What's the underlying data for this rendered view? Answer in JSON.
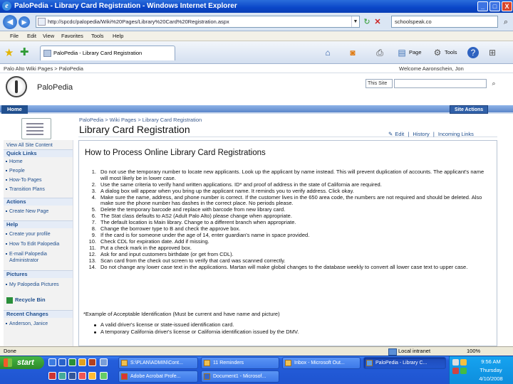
{
  "window": {
    "title": "PaloPedia - Library Card Registration - Windows Internet Explorer",
    "buttons": {
      "minimize": "_",
      "maximize": "□",
      "close": "X"
    }
  },
  "addressbar": {
    "url": "http://spcdc/palopedia/Wiki%20Pages/Library%20Card%20Registration.aspx",
    "search_value": "schoolspeak.co"
  },
  "menubar": {
    "items": [
      "File",
      "Edit",
      "View",
      "Favorites",
      "Tools",
      "Help"
    ]
  },
  "tabs": [
    {
      "label": "PaloPedia - Library Card Registration"
    }
  ],
  "commandbar": {
    "page_label": "Page",
    "tools_label": "Tools"
  },
  "sharepoint": {
    "site_crumb": "Palo Alto Wiki Pages > PaloPedia",
    "welcome": "Welcome Aaronschein, Jon",
    "site_title": "PaloPedia",
    "search_scope": "This Site",
    "home_tab": "Home",
    "site_actions": "Site Actions"
  },
  "page": {
    "breadcrumb": "PaloPedia > Wiki Pages > Library Card Registration",
    "title": "Library Card Registration",
    "toolbar": [
      "Edit",
      "History",
      "Incoming Links"
    ]
  },
  "leftnav": {
    "view_all": "View All Site Content",
    "sections": [
      {
        "header": "Quick Links",
        "items": [
          "Home",
          "People",
          "How-To Pages",
          "Transition Plans"
        ]
      },
      {
        "header": "Actions",
        "items": [
          "Create New Page"
        ]
      },
      {
        "header": "Help",
        "items": [
          "Create your profile",
          "How To Edit Palopedia",
          "E-mail Palopedia Administrator"
        ]
      },
      {
        "header": "Pictures",
        "items": [
          "My Palopedia Pictures"
        ]
      }
    ],
    "recycle_bin": "Recycle Bin",
    "recent_header": "Recent Changes",
    "recent_items": [
      "Anderson, Janice"
    ]
  },
  "content": {
    "heading": "How to Process Online Library Card Registrations",
    "steps": [
      "Do not use the temporary number to locate new applicants. Look up the applicant by name instead. This will prevent duplication of accounts. The applicant's name will most likely be in lower case.",
      "Use the same criteria to verify hand written applications. ID* and proof of address in the state of California are required.",
      "A dialog box will appear when you bring up the applicant name. It reminds you to verify address. Click okay.",
      "Make sure the name, address, and phone number is correct. If the customer lives in the 650 area code, the numbers are not required and should be deleted. Also make sure the phone number has dashes in the correct place. No periods please.",
      "Delete the temporary barcode and replace with barcode from new library card.",
      "The Stat class defaults to AS2 (Adult Palo Alto) please change when appropriate.",
      "The default location is Main library. Change to a different branch when appropriate.",
      "Change the borrower type to B and check the approve box.",
      "If the card is for someone under the age of 14, enter guardian's name in space provided.",
      "Check CDL for expiration date. Add if missing.",
      "Put a check mark in the approved box.",
      "Ask for and input customers birthdate (or get from CDL).",
      "Scan card from the check out screen to verify that card was scanned correctly.",
      "Do not change any lower case text in the applications. Martan will make global changes to the database weekly to convert all lower case text to upper case."
    ],
    "id_note": "*Example of Acceptable Identification (Must be current and have name and picture)",
    "id_examples": [
      "A valid driver's license or state-issued identification card.",
      "A temporary California driver's license or California identification issued by the DMV."
    ]
  },
  "statusbar": {
    "left": "Done",
    "zone": "Local intranet",
    "zoom": "100%"
  },
  "taskbar": {
    "start": "start",
    "buttons": [
      {
        "label": "S:\\PLAN\\ADMIN\\Cont...",
        "active": false
      },
      {
        "label": "11 Reminders",
        "active": false
      },
      {
        "label": "Inbox - Microsoft Out...",
        "active": false
      },
      {
        "label": "PaloPedia - Library C...",
        "active": true
      },
      {
        "label": "Adobe Acrobat Profe...",
        "active": false
      },
      {
        "label": "Document1 - Microsof...",
        "active": false
      }
    ],
    "time": "9:56 AM",
    "day": "Thursday",
    "date": "4/10/2008"
  }
}
